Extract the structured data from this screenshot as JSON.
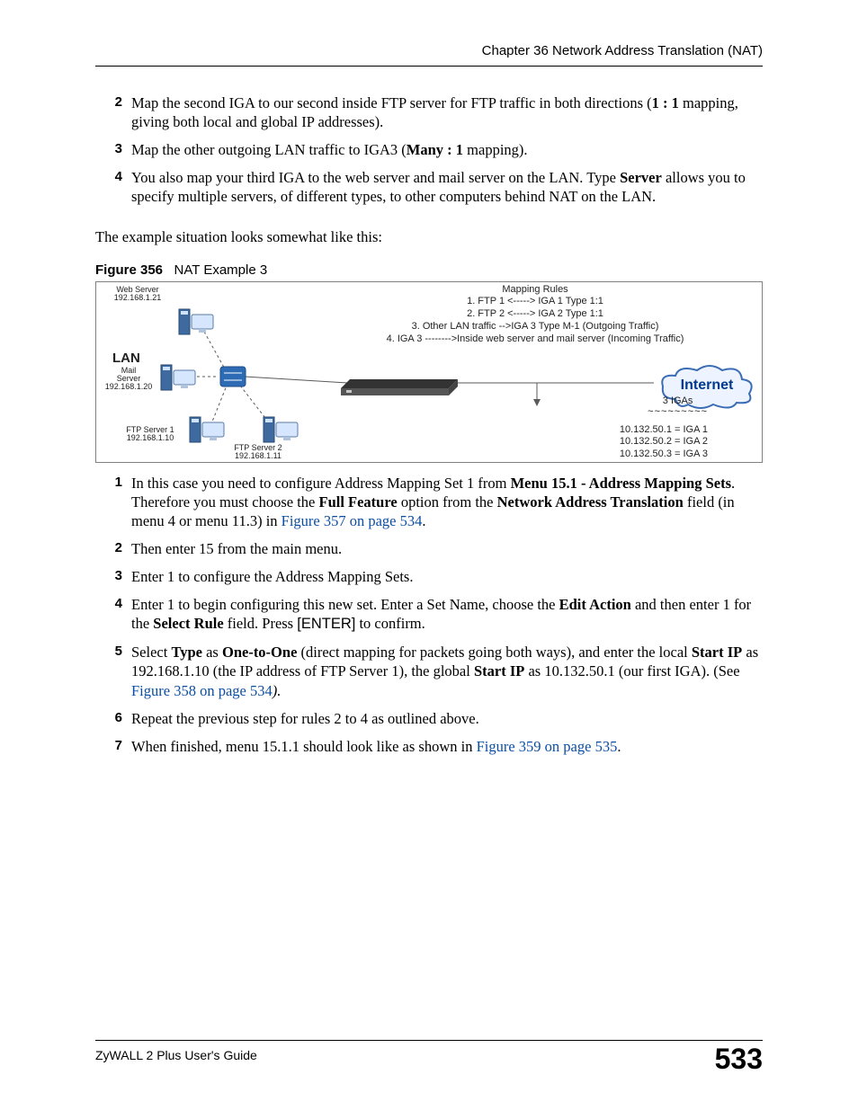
{
  "header": {
    "chapter": "Chapter 36 Network Address Translation (NAT)"
  },
  "stepsA": [
    {
      "n": "2",
      "html": "Map the second IGA to our second inside FTP server for FTP traffic in both directions (<b>1 : 1</b> mapping, giving both local and global IP addresses)."
    },
    {
      "n": "3",
      "html": "Map the other outgoing LAN traffic to IGA3 (<b>Many : 1</b> mapping)."
    },
    {
      "n": "4",
      "html": "You also map your third IGA to the web server and mail server on the LAN. Type <b>Server</b> allows you to specify multiple servers, of different types, to other computers behind NAT on the LAN."
    }
  ],
  "intro": "The example situation looks somewhat like this:",
  "figure": {
    "label": "Figure 356",
    "title": "NAT Example 3",
    "mapping_title": "Mapping Rules",
    "rules": [
      "1. FTP 1 <-----> IGA 1 Type 1:1",
      "2. FTP 2 <-----> IGA 2 Type 1:1",
      "3. Other LAN traffic -->IGA 3 Type M-1 (Outgoing Traffic)",
      "4. IGA 3 -------->Inside web server and mail server (Incoming Traffic)"
    ],
    "lan": "LAN",
    "internet": "Internet",
    "devices": {
      "web": {
        "name": "Web Server",
        "ip": "192.168.1.21"
      },
      "mail": {
        "name": "Mail\nServer",
        "ip": "192.168.1.20"
      },
      "ftp1": {
        "name": "FTP Server 1",
        "ip": "192.168.1.10"
      },
      "ftp2": {
        "name": "FTP Server 2",
        "ip": "192.168.1.11"
      }
    },
    "igas_label": "3 IGAs",
    "igas": [
      "10.132.50.1 = IGA 1",
      "10.132.50.2 = IGA 2",
      "10.132.50.3 = IGA 3"
    ]
  },
  "stepsB": [
    {
      "n": "1",
      "html": "In this case you need to configure Address Mapping Set 1 from <b>Menu 15.1 - Address Mapping Sets</b>. Therefore you must choose the <b>Full Feature</b> option from the <b>Network Address Translation</b> field (in menu 4 or menu 11.3) in <span class='lnk'>Figure 357 on page 534</span>."
    },
    {
      "n": "2",
      "html": "Then enter 15 from the main menu."
    },
    {
      "n": "3",
      "html": "Enter 1 to configure the Address Mapping Sets."
    },
    {
      "n": "4",
      "html": "Enter 1 to begin configuring this new set. Enter a Set Name, choose the <b>Edit Action</b> and then enter 1 for the <b>Select Rule</b> field. Press <span class='sans'>[ENTER]</span> to confirm."
    },
    {
      "n": "5",
      "html": "Select <b>Type</b> as <b>One-to-One</b> (direct mapping for packets going both ways), and enter the local <b>Start IP</b> as 192.168.1.10 (the IP address of FTP Server 1), the global <b>Start IP</b> as 10.132.50.1 (our first IGA). (See <span class='lnk'>Figure 358 on page 534</span><span class='smi'>).</span>"
    },
    {
      "n": "6",
      "html": "Repeat the previous step for rules 2 to 4 as outlined above."
    },
    {
      "n": "7",
      "html": "When finished, menu 15.1.1 should look like as shown in <span class='lnk'>Figure 359 on page 535</span>."
    }
  ],
  "footer": {
    "guide": "ZyWALL 2 Plus User's Guide",
    "page": "533"
  }
}
